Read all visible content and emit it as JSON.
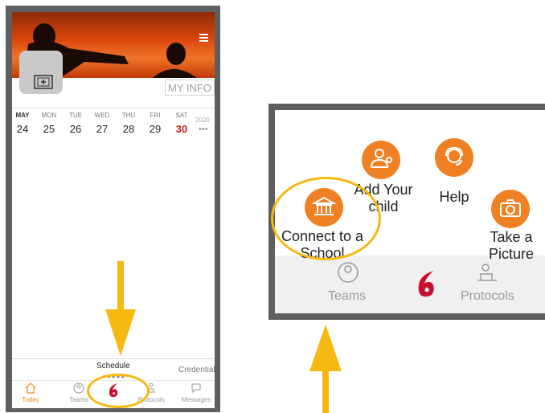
{
  "app": {
    "hero_button": "MY INFO",
    "calendar": {
      "days": [
        {
          "name": "MAY",
          "date": "24"
        },
        {
          "name": "MON",
          "date": "25"
        },
        {
          "name": "TUE",
          "date": "26"
        },
        {
          "name": "WED",
          "date": "27"
        },
        {
          "name": "THU",
          "date": "28"
        },
        {
          "name": "FRI",
          "date": "29"
        },
        {
          "name": "SAT",
          "date": "30"
        }
      ],
      "year": "2020",
      "more": "•••"
    },
    "tabs": {
      "active": "Schedule",
      "next": "Credential",
      "dots": "●●●●●"
    },
    "bottom_nav": {
      "today": "Today",
      "teams": "Teams",
      "protocols": "Protocols",
      "messages": "Messages"
    }
  },
  "zoom": {
    "add_child": "Add Your child",
    "help": "Help",
    "connect_school": "Connect to a School",
    "take_picture": "Take a Picture",
    "teams": "Teams",
    "protocols": "Protocols"
  },
  "colors": {
    "accent": "#ef8124",
    "highlight": "#f5b911",
    "today": "#cc1d1d",
    "brand": "#c8102e"
  },
  "icons": [
    "menu-icon",
    "camera-icon",
    "home-icon",
    "teams-icon",
    "brand-logo-icon",
    "protocols-icon",
    "messages-icon",
    "school-icon",
    "child-icon",
    "help-icon"
  ]
}
